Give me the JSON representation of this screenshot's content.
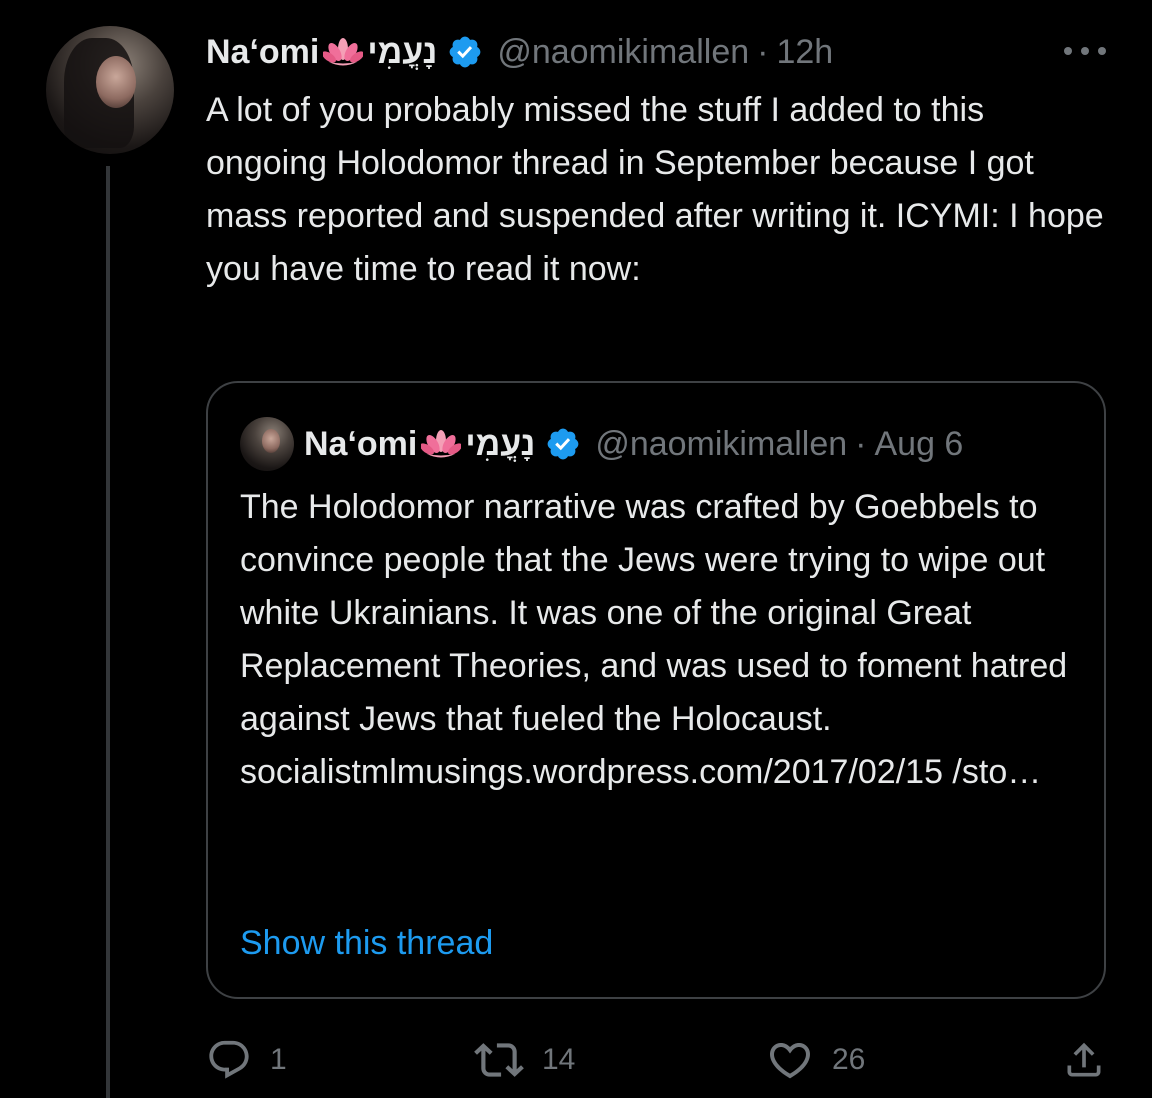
{
  "tweet": {
    "display_name": "Naʻomi",
    "hebrew_name": "נָעֳמִי",
    "handle": "@naomikimallen",
    "separator": "·",
    "time": "12h",
    "text": "A lot of you probably missed the stuff I added to this ongoing Holodomor thread in September because I got mass reported and suspended after writing it. ICYMI: I hope you have time to read it now:",
    "icons": {
      "avatar": "avatar",
      "name_emoji": "lotus-icon",
      "verified": "verified-badge-icon",
      "more": "more-options-icon"
    }
  },
  "quoted_tweet": {
    "display_name": "Naʻomi",
    "hebrew_name": "נָעֳמִי",
    "handle": "@naomikimallen",
    "separator": "·",
    "date": "Aug 6",
    "text": "The Holodomor narrative was crafted by Goebbels to convince people that the Jews were trying to wipe out white Ukrainians. It was one of the original Great Replacement Theories, and was used to foment hatred against Jews that fueled the Holocaust. socialistmlmusings.wordpress.com/2017/02/15 /sto…",
    "show_thread": "Show this thread"
  },
  "actions": {
    "reply_count": "1",
    "retweet_count": "14",
    "like_count": "26",
    "icons": [
      "reply-icon",
      "retweet-icon",
      "like-icon",
      "share-icon"
    ]
  },
  "colors": {
    "background": "#000000",
    "text": "#e7e9ea",
    "muted": "#71767b",
    "accent": "#1d9bf0",
    "border": "#3e4144"
  }
}
